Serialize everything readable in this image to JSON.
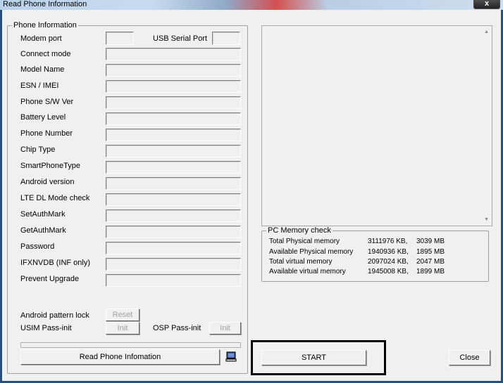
{
  "window": {
    "title": "Read Phone Information",
    "close_label": "x"
  },
  "phone_info": {
    "legend": "Phone Information",
    "modem_port_label": "Modem port",
    "usb_serial_port_label": "USB Serial Port",
    "labels": [
      "Connect mode",
      "Model Name",
      "ESN / IMEI",
      "Phone S/W Ver",
      "Battery Level",
      "Phone Number",
      "Chip Type",
      "SmartPhoneType",
      "Android version",
      "LTE DL Mode check",
      "SetAuthMark",
      "GetAuthMark",
      "Password",
      "IFXNVDB (INF only)",
      "Prevent Upgrade"
    ],
    "android_pattern_lock_label": "Android pattern lock",
    "reset_label": "Reset",
    "usim_pass_init_label": "USIM Pass-init",
    "init_label": "Init",
    "osp_pass_init_label": "OSP Pass-init",
    "osp_init_label": "Init",
    "read_button_label": "Read Phone Infomation",
    "save_icon": "computer-icon"
  },
  "pc_memory": {
    "legend": "PC Memory check",
    "rows": [
      {
        "label": "Total Physical memory",
        "kb": "3111976 KB,",
        "mb": "3039 MB"
      },
      {
        "label": "Available Physical memory",
        "kb": "1940936 KB,",
        "mb": "1895 MB"
      },
      {
        "label": "Total virtual memory",
        "kb": "2097024 KB,",
        "mb": "2047 MB"
      },
      {
        "label": "Available virtual memory",
        "kb": "1945008 KB,",
        "mb": "1899 MB"
      }
    ]
  },
  "actions": {
    "start_label": "START",
    "close_label": "Close"
  }
}
